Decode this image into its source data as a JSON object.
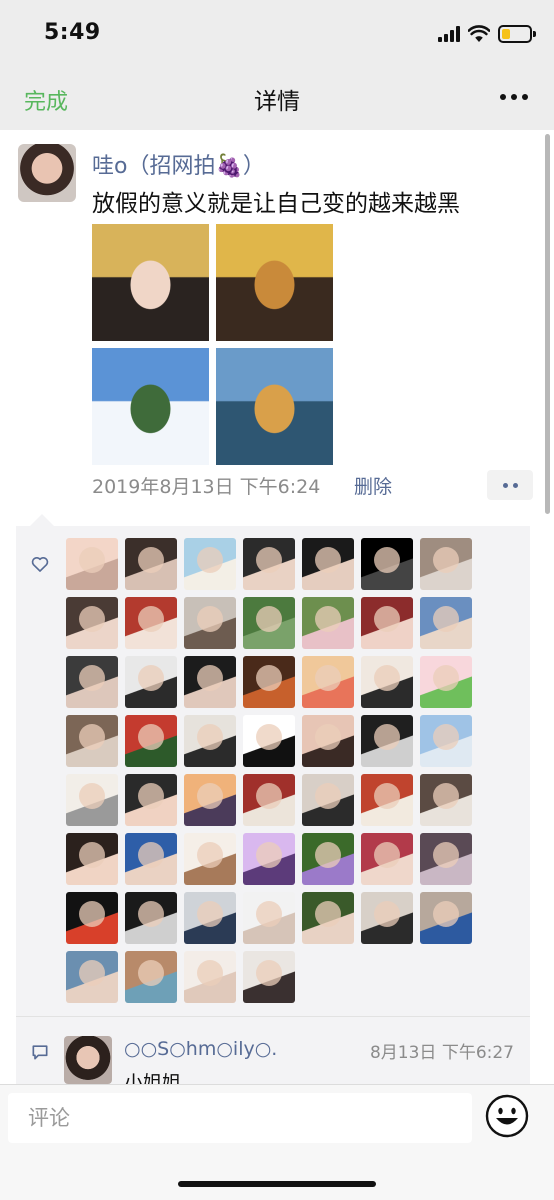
{
  "status_bar": {
    "time": "5:49",
    "battery_level": 0.3,
    "battery_color": "#f6c21a"
  },
  "nav": {
    "done_label": "完成",
    "title": "详情",
    "more_icon": "more-dots-icon",
    "accent_color": "#58b75d"
  },
  "post": {
    "author": "哇o（招网拍🍇）",
    "text": "放假的意义就是让自己变的越来越黑",
    "photos": [
      {
        "desc": "girl-in-black-hat",
        "colors": [
          "#d8b35a",
          "#2a2320",
          "#f0d6c7"
        ]
      },
      {
        "desc": "girl-by-yellow-wall",
        "colors": [
          "#e0b64a",
          "#3a2a1f",
          "#c98a3a"
        ]
      },
      {
        "desc": "mountain-view-sky",
        "colors": [
          "#5b93d6",
          "#f2f6fb",
          "#3f6b3a"
        ]
      },
      {
        "desc": "boat-on-lake",
        "colors": [
          "#6a9bc9",
          "#2e5672",
          "#d9a04a"
        ]
      }
    ],
    "timestamp": "2019年8月13日 下午6:24",
    "delete_label": "删除",
    "link_color": "#576b95"
  },
  "likes": {
    "icon": "heart-icon",
    "likers": [
      {
        "colors": [
          "#f3d6c8",
          "#c9a89a"
        ]
      },
      {
        "colors": [
          "#3b2f2a",
          "#d7c0b3"
        ]
      },
      {
        "colors": [
          "#a9d0e6",
          "#f3efe6"
        ]
      },
      {
        "colors": [
          "#2b2b2b",
          "#e9d2c4"
        ]
      },
      {
        "colors": [
          "#1a1a1a",
          "#e5cdbf"
        ]
      },
      {
        "colors": [
          "#000000",
          "#444444"
        ]
      },
      {
        "colors": [
          "#9f8d80",
          "#dcd3cc"
        ]
      },
      {
        "colors": [
          "#4a3b35",
          "#ecd5c9"
        ]
      },
      {
        "colors": [
          "#b33a2e",
          "#f2e2d8"
        ]
      },
      {
        "colors": [
          "#c8c0b8",
          "#6d5c50"
        ]
      },
      {
        "colors": [
          "#4c7a3e",
          "#7aa26a"
        ]
      },
      {
        "colors": [
          "#6d8f4e",
          "#e8c1c7"
        ]
      },
      {
        "colors": [
          "#8c2c2c",
          "#efd2c7"
        ]
      },
      {
        "colors": [
          "#6a8fc0",
          "#e8d6c8"
        ]
      },
      {
        "colors": [
          "#3b3b3b",
          "#ddc7bb"
        ]
      },
      {
        "colors": [
          "#e8e8e8",
          "#2b2b2b"
        ]
      },
      {
        "colors": [
          "#1c1c1c",
          "#e0c8bb"
        ]
      },
      {
        "colors": [
          "#4a2a1a",
          "#c7602c"
        ]
      },
      {
        "colors": [
          "#f0c89a",
          "#e8745a"
        ]
      },
      {
        "colors": [
          "#f0e8e0",
          "#2b2b2b"
        ]
      },
      {
        "colors": [
          "#f8d7dc",
          "#6fbf5c"
        ]
      },
      {
        "colors": [
          "#7c6656",
          "#d9cbbf"
        ]
      },
      {
        "colors": [
          "#c43b2f",
          "#2d5a2a"
        ]
      },
      {
        "colors": [
          "#e6e2dc",
          "#2b2b2b"
        ]
      },
      {
        "colors": [
          "#ffffff",
          "#111111"
        ]
      },
      {
        "colors": [
          "#e7c5b5",
          "#3a2a25"
        ]
      },
      {
        "colors": [
          "#1f1f1f",
          "#cfcfcf"
        ]
      },
      {
        "colors": [
          "#9fc3e6",
          "#dfe9f2"
        ]
      },
      {
        "colors": [
          "#f2eee8",
          "#9a9a9a"
        ]
      },
      {
        "colors": [
          "#2a2a2a",
          "#f0d2c2"
        ]
      },
      {
        "colors": [
          "#f0b27a",
          "#4b3b5a"
        ]
      },
      {
        "colors": [
          "#a0302b",
          "#ece4da"
        ]
      },
      {
        "colors": [
          "#d8cfc7",
          "#2b2b2b"
        ]
      },
      {
        "colors": [
          "#c0442e",
          "#f2eadf"
        ]
      },
      {
        "colors": [
          "#5b4b43",
          "#e8e2db"
        ]
      },
      {
        "colors": [
          "#2b211d",
          "#f0d4c4"
        ]
      },
      {
        "colors": [
          "#2e5ea8",
          "#ead2c3"
        ]
      },
      {
        "colors": [
          "#f5efe8",
          "#a77a5a"
        ]
      },
      {
        "colors": [
          "#d9b8ef",
          "#5c3b7a"
        ]
      },
      {
        "colors": [
          "#3b6a2a",
          "#9b7ac9"
        ]
      },
      {
        "colors": [
          "#b23a4a",
          "#efd7cb"
        ]
      },
      {
        "colors": [
          "#5a4a55",
          "#c9b7c4"
        ]
      },
      {
        "colors": [
          "#121212",
          "#d8402a"
        ]
      },
      {
        "colors": [
          "#1a1a1a",
          "#cfcfcf"
        ]
      },
      {
        "colors": [
          "#cfd3d8",
          "#2b3b55"
        ]
      },
      {
        "colors": [
          "#f2f2f2",
          "#d6c4b8"
        ]
      },
      {
        "colors": [
          "#3a5a2a",
          "#e8d2c4"
        ]
      },
      {
        "colors": [
          "#d8d0c8",
          "#2b2b2b"
        ]
      },
      {
        "colors": [
          "#b7a89c",
          "#2d5aa0"
        ]
      },
      {
        "colors": [
          "#6b8fb0",
          "#e6d0c2"
        ]
      },
      {
        "colors": [
          "#b88a6a",
          "#6ea0b7"
        ]
      },
      {
        "colors": [
          "#f3ede8",
          "#e0c9bb"
        ]
      },
      {
        "colors": [
          "#eae6e2",
          "#3a3030"
        ]
      }
    ]
  },
  "comment": {
    "icon": "comment-icon",
    "author": "○○S○hm○ily○.",
    "time": "8月13日 下午6:27",
    "text": "小姐姐"
  },
  "input": {
    "placeholder": "评论",
    "emoji_icon": "emoji-smile-icon"
  }
}
